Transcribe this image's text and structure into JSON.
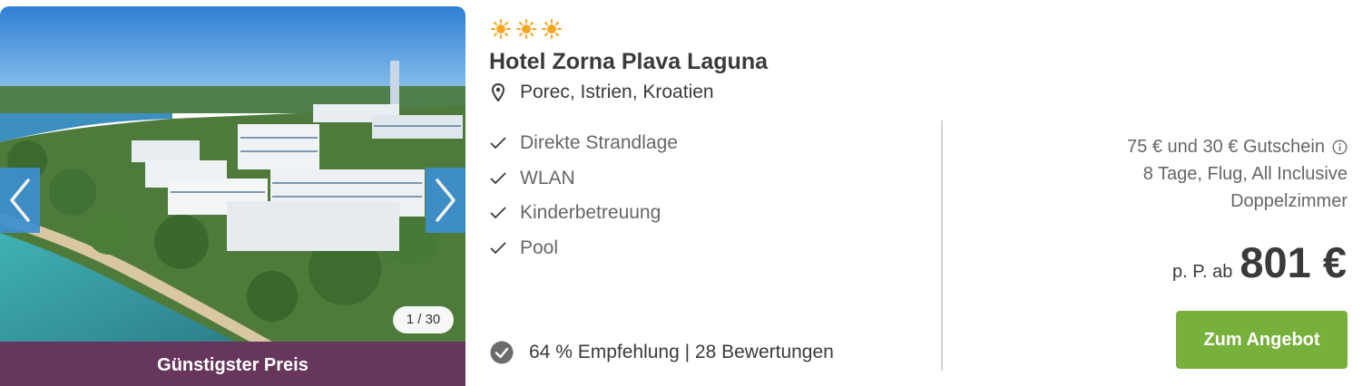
{
  "hotel": {
    "stars": 3,
    "star_icon": "sun-icon",
    "name": "Hotel Zorna Plava Laguna",
    "location": "Porec, Istrien, Kroatien"
  },
  "gallery": {
    "counter": "1 / 30",
    "prev_icon": "chevron-left-icon",
    "next_icon": "chevron-right-icon",
    "badge": "Günstigster Preis"
  },
  "features": [
    {
      "label": "Direkte Strandlage"
    },
    {
      "label": "WLAN"
    },
    {
      "label": "Kinderbetreuung"
    },
    {
      "label": "Pool"
    }
  ],
  "recommendation": {
    "text": "64 % Empfehlung | 28 Bewertungen"
  },
  "offer": {
    "voucher": "75 € und 30 € Gutschein",
    "details": "8 Tage, Flug, All Inclusive",
    "room": "Doppelzimmer",
    "price_prefix": "p. P. ab",
    "price": "801 €",
    "cta_label": "Zum Angebot"
  },
  "colors": {
    "badge_bg": "#66365c",
    "cta_bg": "#78b03c",
    "arrow_bg": "#3d8fd0",
    "sun": "#f5a623"
  }
}
